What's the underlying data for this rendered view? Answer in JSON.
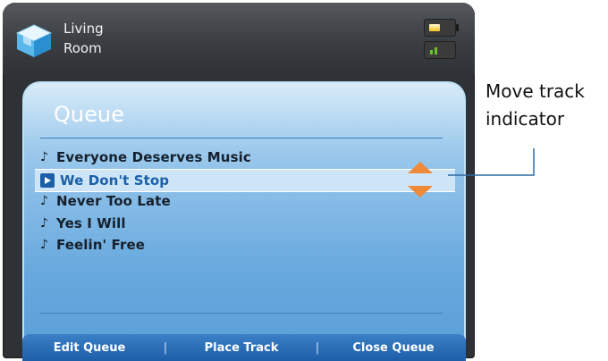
{
  "header": {
    "room_line1": "Living",
    "room_line2": "Room",
    "room_icon": "cube-icon",
    "battery_level": 0.55,
    "signal_bars": 2
  },
  "queue": {
    "title": "Queue",
    "tracks": [
      {
        "title": "Everyone Deserves Music",
        "icon": "music-note-icon",
        "selected": false
      },
      {
        "title": "We Don't Stop",
        "icon": "play-icon",
        "selected": true
      },
      {
        "title": "Never Too Late",
        "icon": "music-note-icon",
        "selected": false
      },
      {
        "title": "Yes I Will",
        "icon": "music-note-icon",
        "selected": false
      },
      {
        "title": "Feelin' Free",
        "icon": "music-note-icon",
        "selected": false
      }
    ],
    "move_up_icon": "arrow-up-icon",
    "move_down_icon": "arrow-down-icon"
  },
  "bottom_bar": {
    "edit_queue": "Edit Queue",
    "separator": "|",
    "place_track": "Place Track",
    "close_queue": "Close Queue"
  },
  "callout": {
    "line1": "Move track",
    "line2": "indicator"
  },
  "colors": {
    "panel_blue": "#68a9de",
    "selected_text": "#1b5fa8",
    "arrow_orange": "#ee8a3a",
    "bar_blue": "#1d5ea8"
  }
}
